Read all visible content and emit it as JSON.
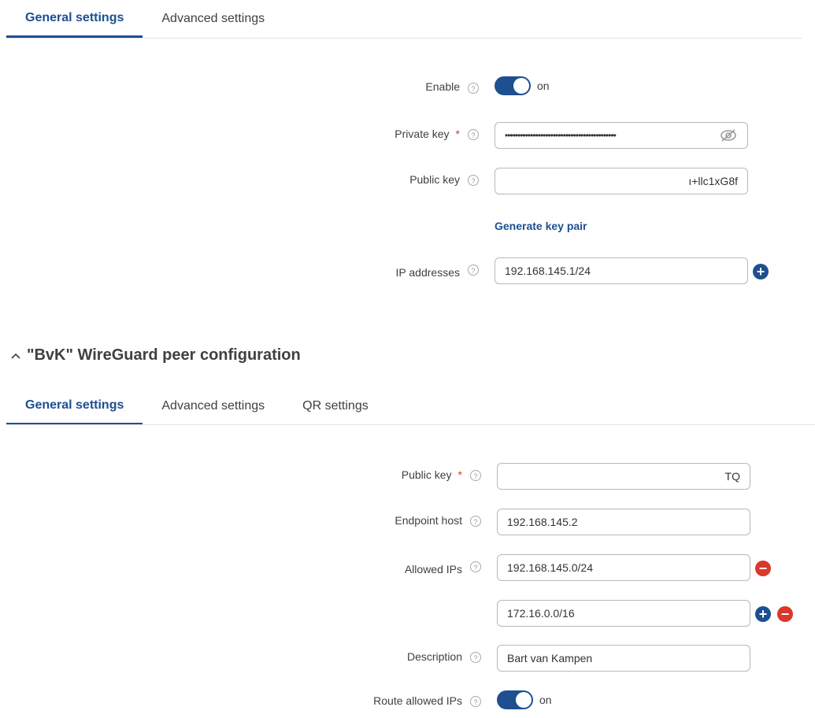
{
  "interface_tabs": [
    {
      "label": "General settings",
      "active": true
    },
    {
      "label": "Advanced settings",
      "active": false
    }
  ],
  "interface": {
    "enable": {
      "label": "Enable",
      "state": "on"
    },
    "private_key": {
      "label": "Private key",
      "required": "*",
      "value": "••••••••••••••••••••••••••••••••••••••••••••"
    },
    "public_key": {
      "label": "Public key",
      "value": "ı+llc1xG8f"
    },
    "generate_label": "Generate key pair",
    "ip_addresses": {
      "label": "IP addresses",
      "value": "192.168.145.1/24"
    }
  },
  "peer": {
    "section_title": "\"BvK\" WireGuard peer configuration",
    "tabs": [
      {
        "label": "General settings",
        "active": true
      },
      {
        "label": "Advanced settings",
        "active": false
      },
      {
        "label": "QR settings",
        "active": false
      }
    ],
    "public_key": {
      "label": "Public key",
      "required": "*",
      "value": "TQ"
    },
    "endpoint_host": {
      "label": "Endpoint host",
      "value": "192.168.145.2"
    },
    "allowed_ips": {
      "label": "Allowed IPs",
      "values": [
        "192.168.145.0/24",
        "172.16.0.0/16"
      ]
    },
    "description": {
      "label": "Description",
      "value": "Bart van Kampen"
    },
    "route_allowed_ips": {
      "label": "Route allowed IPs",
      "state": "on"
    }
  },
  "help_glyph": "?",
  "add_glyph": "+",
  "remove_glyph": "−",
  "colors": {
    "accent": "#1d4f91",
    "danger": "#d9382b"
  },
  "icons": {
    "eye_off": "eye-off-icon",
    "chevron_up": "chevron-up-icon"
  }
}
